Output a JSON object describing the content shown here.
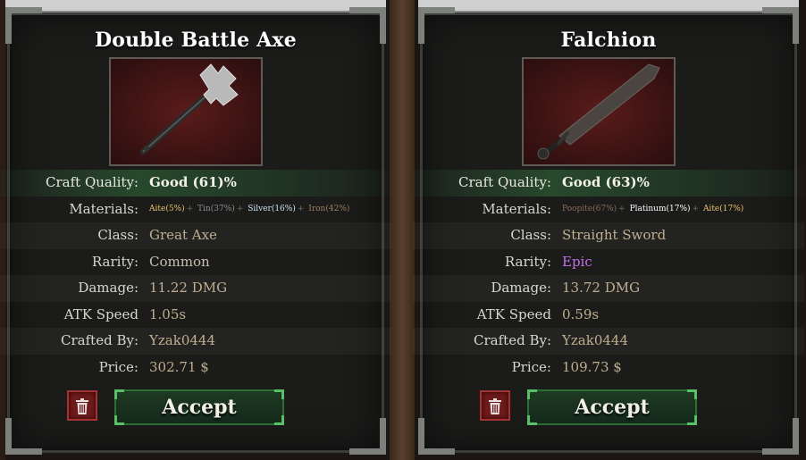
{
  "cards": [
    {
      "title": "Double Battle Axe",
      "image_icon": "double-battle-axe-icon",
      "fields": {
        "craft_quality": {
          "label": "Craft Quality:",
          "value": "Good (61)%"
        },
        "materials": {
          "label": "Materials:",
          "items": [
            "Aite(5%)",
            "Tin(37%)",
            "Silver(16%)",
            "Iron(42%)"
          ],
          "separator": "+"
        },
        "class": {
          "label": "Class:",
          "value": "Great Axe"
        },
        "rarity": {
          "label": "Rarity:",
          "value": "Common"
        },
        "damage": {
          "label": "Damage:",
          "value": "11.22 DMG"
        },
        "atk_speed": {
          "label": "ATK Speed",
          "value": "1.05s"
        },
        "crafted_by": {
          "label": "Crafted By:",
          "value": "Yzak0444"
        },
        "price": {
          "label": "Price:",
          "value": "302.71 $"
        }
      },
      "accept_label": "Accept",
      "delete_icon": "trash-icon"
    },
    {
      "title": "Falchion",
      "image_icon": "falchion-icon",
      "fields": {
        "craft_quality": {
          "label": "Craft Quality:",
          "value": "Good (63)%"
        },
        "materials": {
          "label": "Materials:",
          "items": [
            "Poopite(67%)",
            "Platinum(17%)",
            "Aite(17%)"
          ],
          "separator": "+"
        },
        "class": {
          "label": "Class:",
          "value": "Straight Sword"
        },
        "rarity": {
          "label": "Rarity:",
          "value": "Epic"
        },
        "damage": {
          "label": "Damage:",
          "value": "13.72 DMG"
        },
        "atk_speed": {
          "label": "ATK Speed",
          "value": "0.59s"
        },
        "crafted_by": {
          "label": "Crafted By:",
          "value": "Yzak0444"
        },
        "price": {
          "label": "Price:",
          "value": "109.73 $"
        }
      },
      "accept_label": "Accept",
      "delete_icon": "trash-icon"
    }
  ],
  "colors": {
    "quality_bar": "#2f6e3a",
    "epic": "#c070e8",
    "accept_border": "#58c066",
    "trash_bg": "#6e1b1b"
  }
}
